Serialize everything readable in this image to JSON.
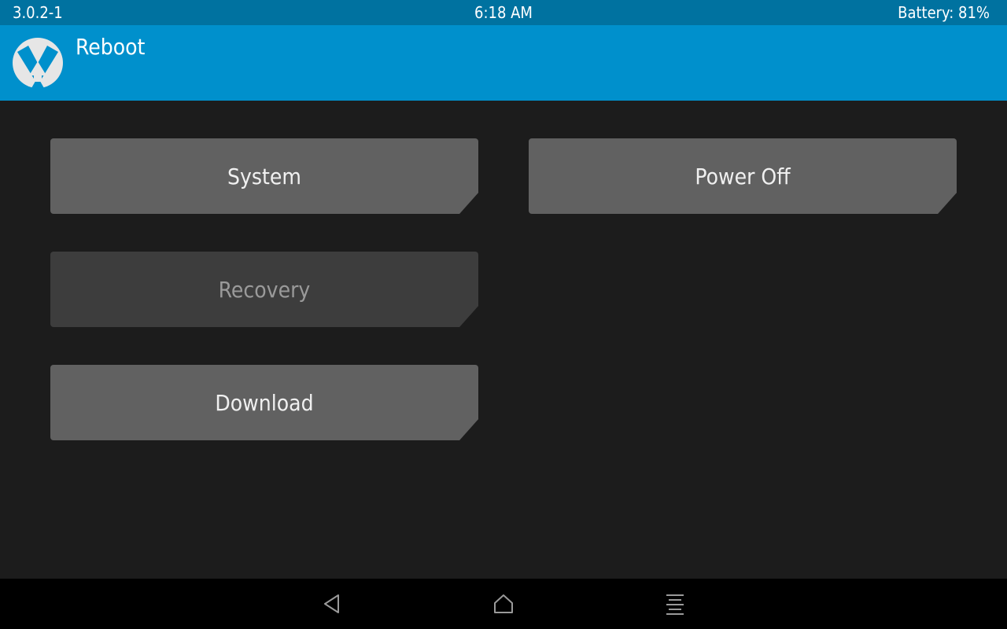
{
  "status_bar": {
    "version": "3.0.2-1",
    "time": "6:18 AM",
    "battery": "Battery: 81%"
  },
  "header": {
    "title": "Reboot",
    "logo_icon": "twrp-logo-icon"
  },
  "buttons": {
    "system": "System",
    "power_off": "Power Off",
    "recovery": "Recovery",
    "download": "Download"
  },
  "button_states": {
    "recovery": "disabled"
  },
  "navbar": {
    "back_icon": "back-icon",
    "home_icon": "home-icon",
    "menu_icon": "menu-icon"
  },
  "colors": {
    "status_bar": "#0072a0",
    "header": "#0090cc",
    "background": "#1c1c1c",
    "button": "#616161",
    "button_disabled": "#3d3d3d",
    "navbar": "#000000"
  }
}
